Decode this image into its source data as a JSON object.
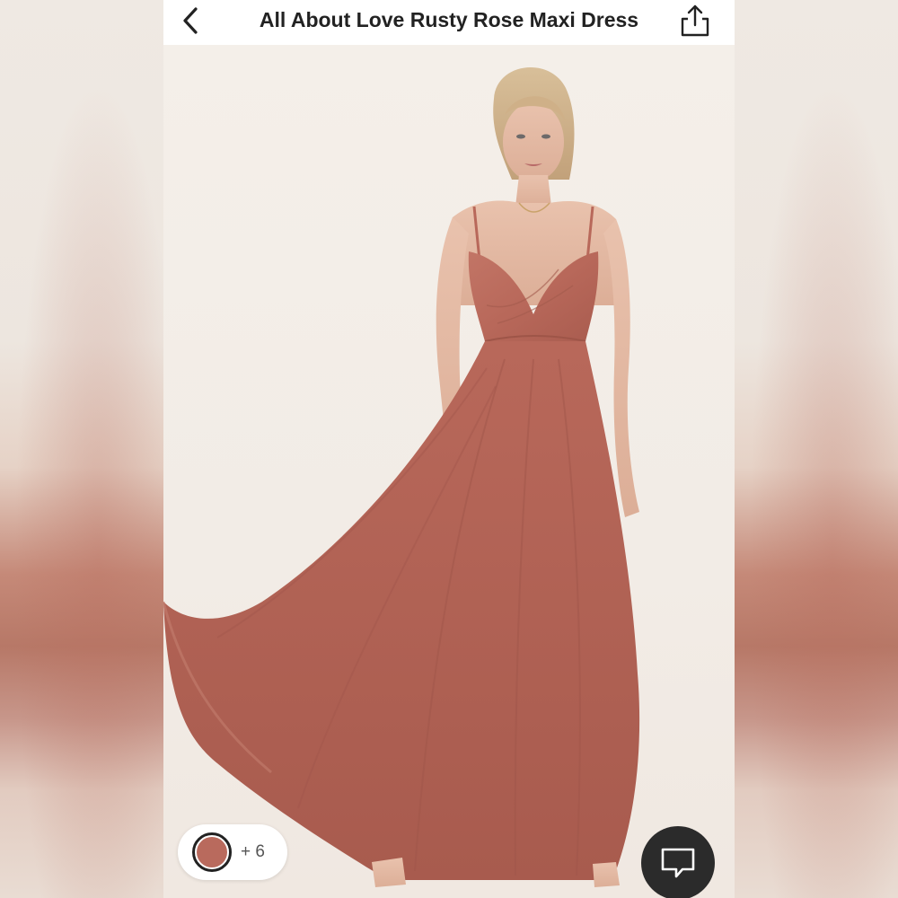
{
  "header": {
    "title": "All About Love Rusty Rose Maxi Dress",
    "back_icon": "chevron-left-icon",
    "share_icon": "share-icon"
  },
  "product_image": {
    "subject": "model wearing rusty rose maxi dress"
  },
  "colors": {
    "selected_swatch": "#b96a5d",
    "more_count": "+ 6"
  },
  "chat": {
    "icon": "chat-bubble-icon"
  },
  "theme": {
    "dress": "#b8685a",
    "background": "#f3ede7",
    "dark_button": "#2b2b2b"
  }
}
